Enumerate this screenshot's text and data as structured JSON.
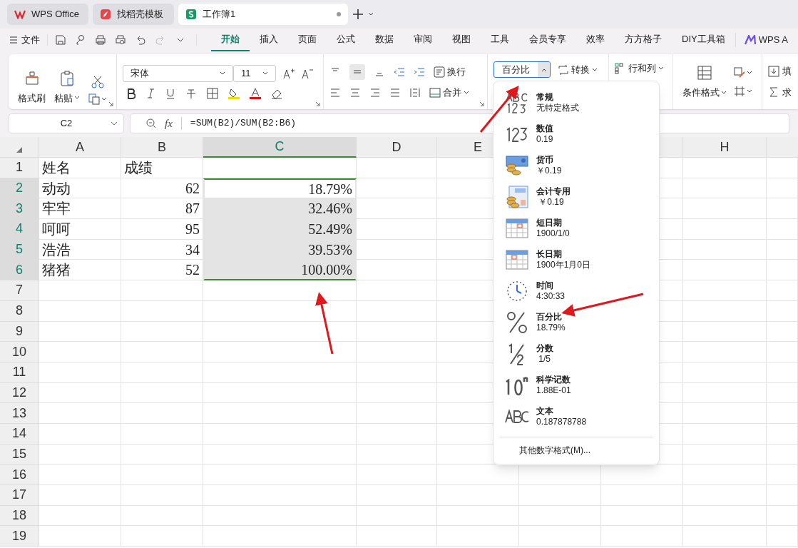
{
  "app_tabs": [
    {
      "label": "WPS Office",
      "kind": "wps",
      "selected": false
    },
    {
      "label": "找稻壳模板",
      "kind": "template",
      "selected": false
    },
    {
      "label": "工作簿1",
      "kind": "sheet",
      "selected": true
    }
  ],
  "menu": {
    "file": "文件",
    "tabs": [
      {
        "label": "开始",
        "selected": true
      },
      {
        "label": "插入",
        "selected": false
      },
      {
        "label": "页面",
        "selected": false
      },
      {
        "label": "公式",
        "selected": false
      },
      {
        "label": "数据",
        "selected": false
      },
      {
        "label": "审阅",
        "selected": false
      },
      {
        "label": "视图",
        "selected": false
      },
      {
        "label": "工具",
        "selected": false
      },
      {
        "label": "会员专享",
        "selected": false
      },
      {
        "label": "效率",
        "selected": false
      },
      {
        "label": "方方格子",
        "selected": false
      },
      {
        "label": "DIY工具箱",
        "selected": false
      }
    ],
    "ai": "WPS A"
  },
  "ribbon": {
    "format_painter": "格式刷",
    "paste": "粘贴",
    "font": "宋体",
    "font_size": "11",
    "wrap": "换行",
    "merge": "合并",
    "number_format": "百分比",
    "convert": "转换",
    "rows_cols": "行和列",
    "conditional": "条件格式",
    "fill": "填",
    "sum": "求"
  },
  "formula_bar": {
    "name_box": "C2",
    "function_label": "fx",
    "formula": "=SUM(B2)/SUM(B2:B6)"
  },
  "sheet": {
    "columns": [
      {
        "label": "A",
        "selected": false
      },
      {
        "label": "B",
        "selected": false
      },
      {
        "label": "C",
        "selected": true
      },
      {
        "label": "D",
        "selected": false
      },
      {
        "label": "E",
        "selected": false
      }
    ],
    "columns_right": [
      {
        "label": "H",
        "selected": false
      }
    ],
    "rows": [
      {
        "number": "1",
        "selected": false,
        "kind": "header",
        "cells": [
          "姓名",
          "成绩",
          ""
        ]
      },
      {
        "number": "2",
        "selected": true,
        "cells": [
          "动动",
          "62",
          "18.79%"
        ]
      },
      {
        "number": "3",
        "selected": true,
        "cells": [
          "牢牢",
          "87",
          "32.46%"
        ]
      },
      {
        "number": "4",
        "selected": true,
        "cells": [
          "呵呵",
          "95",
          "52.49%"
        ]
      },
      {
        "number": "5",
        "selected": true,
        "cells": [
          "浩浩",
          "34",
          "39.53%"
        ]
      },
      {
        "number": "6",
        "selected": true,
        "cells": [
          "猪猪",
          "52",
          "100.00%"
        ]
      },
      {
        "number": "7",
        "selected": false,
        "cells": []
      },
      {
        "number": "8",
        "selected": false,
        "cells": []
      },
      {
        "number": "9",
        "selected": false,
        "cells": []
      },
      {
        "number": "10",
        "selected": false,
        "cells": []
      },
      {
        "number": "11",
        "selected": false,
        "cells": []
      },
      {
        "number": "12",
        "selected": false,
        "cells": []
      },
      {
        "number": "13",
        "selected": false,
        "cells": []
      },
      {
        "number": "14",
        "selected": false,
        "cells": []
      },
      {
        "number": "15",
        "selected": false,
        "cells": []
      },
      {
        "number": "16",
        "selected": false,
        "cells": []
      },
      {
        "number": "17",
        "selected": false,
        "cells": []
      },
      {
        "number": "18",
        "selected": false,
        "cells": []
      },
      {
        "number": "19",
        "selected": false,
        "cells": []
      }
    ]
  },
  "format_menu": {
    "items": [
      {
        "kind": "general",
        "title": "常规",
        "sample": "无特定格式"
      },
      {
        "kind": "number",
        "title": "数值",
        "sample": "0.19"
      },
      {
        "kind": "currency",
        "title": "货币",
        "sample": "￥0.19"
      },
      {
        "kind": "accounting",
        "title": "会计专用",
        "sample": " ￥0.19"
      },
      {
        "kind": "short_date",
        "title": "短日期",
        "sample": "1900/1/0"
      },
      {
        "kind": "long_date",
        "title": "长日期",
        "sample": "1900年1月0日"
      },
      {
        "kind": "time",
        "title": "时间",
        "sample": "4:30:33"
      },
      {
        "kind": "percent",
        "title": "百分比",
        "sample": "18.79%"
      },
      {
        "kind": "fraction",
        "title": "分数",
        "sample": " 1/5"
      },
      {
        "kind": "scientific",
        "title": "科学记数",
        "sample": "1.88E-01"
      },
      {
        "kind": "text",
        "title": "文本",
        "sample": "0.187878788"
      }
    ],
    "more": "其他数字格式(M)..."
  }
}
